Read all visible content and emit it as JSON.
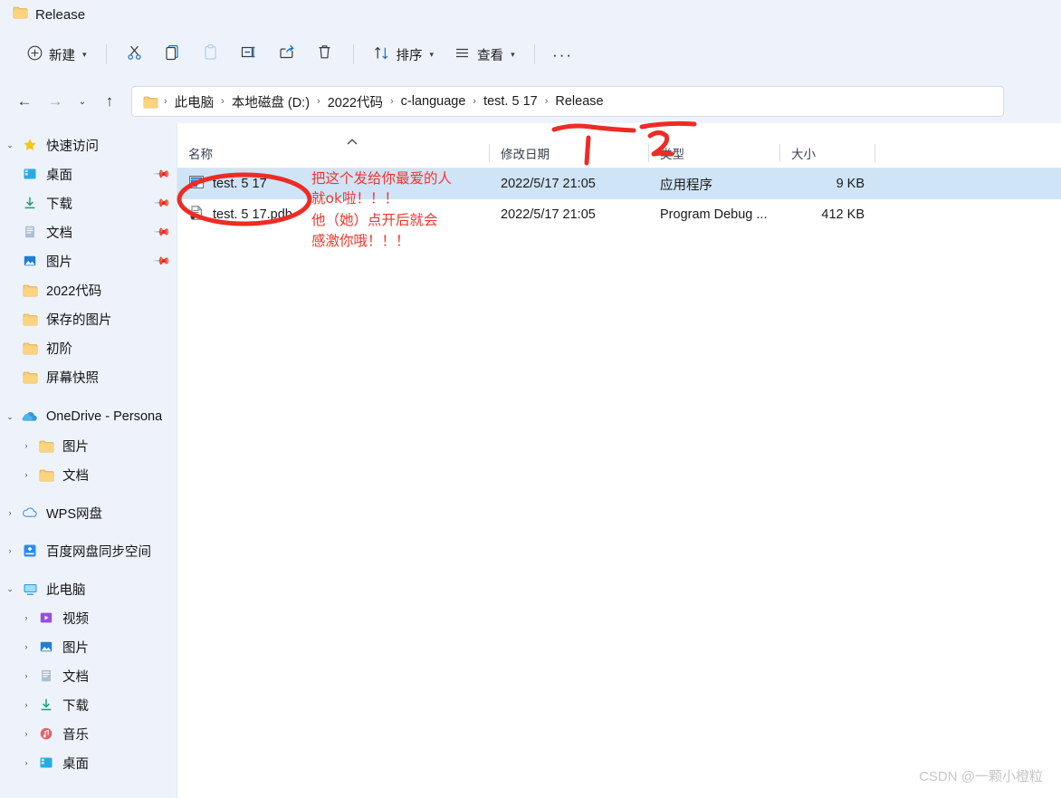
{
  "window": {
    "tab_title": "Release",
    "folder_icon": "folder-icon"
  },
  "toolbar": {
    "new_label": "新建",
    "sort_label": "排序",
    "view_label": "查看",
    "more_label": "···",
    "items": [
      {
        "name": "new-button",
        "label": "新建",
        "icon": "plus-circle-icon"
      },
      {
        "name": "cut-button",
        "label": "",
        "icon": "scissors-icon"
      },
      {
        "name": "copy-button",
        "label": "",
        "icon": "copy-icon"
      },
      {
        "name": "paste-button",
        "label": "",
        "icon": "paste-icon"
      },
      {
        "name": "rename-button",
        "label": "",
        "icon": "rename-icon"
      },
      {
        "name": "share-button",
        "label": "",
        "icon": "share-icon"
      },
      {
        "name": "delete-button",
        "label": "",
        "icon": "trash-icon"
      },
      {
        "name": "sort-button",
        "label": "排序",
        "icon": "sort-icon"
      },
      {
        "name": "view-button",
        "label": "查看",
        "icon": "list-icon"
      },
      {
        "name": "more-button",
        "label": "···",
        "icon": "ellipsis-icon"
      }
    ]
  },
  "address": {
    "back": "←",
    "forward": "→",
    "recent": "⌄",
    "up": "↑",
    "crumbs": [
      "此电脑",
      "本地磁盘 (D:)",
      "2022代码",
      "c-language",
      "test. 5 17",
      "Release"
    ],
    "separator": "›"
  },
  "sidebar": {
    "sections": [
      {
        "name": "quick-access",
        "label": "快速访问",
        "icon": "star-icon",
        "expanded": true,
        "twisty": "⌄",
        "items": [
          {
            "label": "桌面",
            "icon": "desktop-icon",
            "pinned": true
          },
          {
            "label": "下载",
            "icon": "download-icon",
            "pinned": true
          },
          {
            "label": "文档",
            "icon": "document-icon",
            "pinned": true
          },
          {
            "label": "图片",
            "icon": "pictures-icon",
            "pinned": true
          },
          {
            "label": "2022代码",
            "icon": "folder-icon",
            "pinned": false
          },
          {
            "label": "保存的图片",
            "icon": "folder-icon",
            "pinned": false
          },
          {
            "label": "初阶",
            "icon": "folder-icon",
            "pinned": false
          },
          {
            "label": "屏幕快照",
            "icon": "folder-icon",
            "pinned": false
          }
        ]
      },
      {
        "name": "onedrive",
        "label": "OneDrive - Persona",
        "icon": "cloud-icon",
        "expanded": true,
        "twisty": "⌄",
        "items": [
          {
            "label": "图片",
            "icon": "folder-icon",
            "twisty": "›"
          },
          {
            "label": "文档",
            "icon": "folder-icon",
            "twisty": "›"
          }
        ]
      },
      {
        "name": "wps-cloud",
        "label": "WPS网盘",
        "icon": "wps-cloud-icon",
        "expanded": false,
        "twisty": "›",
        "items": []
      },
      {
        "name": "baidu-netdisk",
        "label": "百度网盘同步空间",
        "icon": "baidu-icon",
        "expanded": false,
        "twisty": "›",
        "items": []
      },
      {
        "name": "this-pc",
        "label": "此电脑",
        "icon": "pc-icon",
        "expanded": true,
        "twisty": "⌄",
        "items": [
          {
            "label": "视频",
            "icon": "videos-icon",
            "twisty": "›"
          },
          {
            "label": "图片",
            "icon": "pictures-icon",
            "twisty": "›"
          },
          {
            "label": "文档",
            "icon": "document-icon",
            "twisty": "›"
          },
          {
            "label": "下载",
            "icon": "download-icon",
            "twisty": "›"
          },
          {
            "label": "音乐",
            "icon": "music-icon",
            "twisty": "›"
          },
          {
            "label": "桌面",
            "icon": "desktop-icon",
            "twisty": "›"
          }
        ]
      }
    ]
  },
  "filelist": {
    "columns": [
      "名称",
      "修改日期",
      "类型",
      "大小"
    ],
    "sort_indicator": "^",
    "rows": [
      {
        "name": "test. 5 17",
        "date": "2022/5/17 21:05",
        "type": "应用程序",
        "size": "9 KB",
        "icon": "application-exe-icon",
        "selected": true
      },
      {
        "name": "test. 5 17.pdb",
        "date": "2022/5/17 21:05",
        "type": "Program Debug ...",
        "size": "412 KB",
        "icon": "pdb-file-icon",
        "selected": false
      }
    ]
  },
  "annotations": {
    "color": "#f5342b",
    "lines": [
      "把这个发给你最爱的人",
      "就ok啦！！！",
      "他（她）点开后就会",
      "感激你哦！！！"
    ],
    "marker_one": "1",
    "marker_two": "2"
  },
  "watermark": "CSDN @一颗小橙粒"
}
